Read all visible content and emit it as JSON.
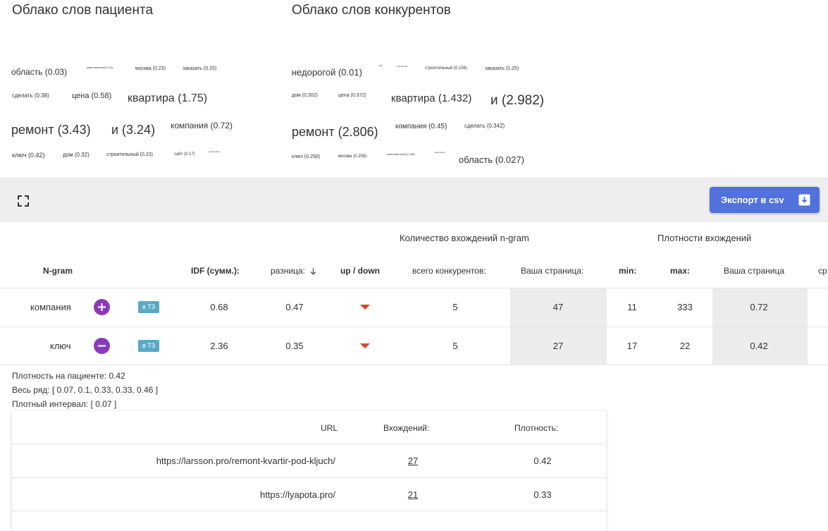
{
  "clouds": {
    "patient": {
      "title": "Облако слов пациента",
      "words": [
        "область (0.03)",
        "качественный (0.12)",
        "москва (0.23)",
        "заказать (0.25)",
        "сделать (0.38)",
        "цена (0.58)",
        "квартира (1.75)",
        "ремонт (3.43)",
        "и (3.24)",
        "компания (0.72)",
        "ключ (0.42)",
        "дом (0.32)",
        "строительный (0.23)",
        "сайт (0.17)",
        "выполнить"
      ]
    },
    "competitors": {
      "title": "Облако слов конкурентов",
      "words": [
        "недорогой (0.01)",
        "сайт",
        "компьютер",
        "строительный (0.156)",
        "заказать (0.25)",
        "дом (0.302)",
        "цена (0.372)",
        "квартира (1.432)",
        "и (2.982)",
        "ремонт (2.806)",
        "компания (0.45)",
        "сделать (0.342)",
        "ключ (0.258)",
        "москва (0.208)",
        "качественный (0.106)",
        "выполнить",
        "область (0.027)"
      ]
    }
  },
  "toolbar": {
    "fullscreen_icon": "fullscreen-icon",
    "export_label": "Экспорт в csv",
    "export_icon": "download-box-icon"
  },
  "table": {
    "group_headers": {
      "ngram_count": "Количество вхождений n-gram",
      "density": "Плотности вхождений"
    },
    "columns": {
      "ngram": "N-gram",
      "idf": "IDF (сумм.):",
      "diff": "разница:",
      "updown": "up / down",
      "total_competitors": "всего конкурентов:",
      "your_page": "Ваша страница:",
      "min": "min:",
      "max": "max:",
      "density_your_page": "Ваша страница",
      "extra": "ср"
    },
    "sort_icon": "arrow-down-icon",
    "rows": [
      {
        "ngram": "компания",
        "action": "plus",
        "badge": "в ТЗ",
        "idf": "0.68",
        "diff": "0.47",
        "trend": "down",
        "total": "5",
        "your_page": "47",
        "min": "11",
        "max": "333",
        "density": "0.72"
      },
      {
        "ngram": "ключ",
        "action": "minus",
        "badge": "в ТЗ",
        "idf": "2.36",
        "diff": "0.35",
        "trend": "down",
        "total": "5",
        "your_page": "27",
        "min": "17",
        "max": "22",
        "density": "0.42"
      }
    ]
  },
  "details": {
    "patient_density": "Плотность на пациенте: 0.42",
    "full_series": "Весь ряд: [ 0.07, 0.1, 0.33, 0.33, 0.46 ]",
    "dense_interval": "Плотный интервал: [ 0.07 ]"
  },
  "sub_table": {
    "headers": {
      "url": "URL",
      "occurrences": "Вхождений:",
      "density": "Плотность:"
    },
    "rows": [
      {
        "url": "https://larsson.pro/remont-kvartir-pod-kljuch/",
        "occurrences": "27",
        "density": "0.42"
      },
      {
        "url": "https://lyapota.pro/",
        "occurrences": "21",
        "density": "0.33"
      }
    ]
  },
  "colors": {
    "export_button": "#5171dd",
    "round_button": "#8a3ab9",
    "badge": "#5aa9c6",
    "down_arrow": "#d9442a",
    "toolbar_bg": "#eeeeee",
    "shaded_cell": "#ececec"
  }
}
